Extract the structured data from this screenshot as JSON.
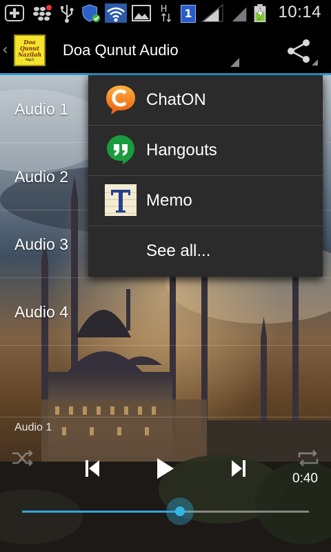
{
  "status_bar": {
    "time": "10:14",
    "network_type": "H",
    "notification_count": "1",
    "icons": [
      "add-icon",
      "blackberry-icon",
      "usb-icon",
      "shield-check-icon",
      "wifi-icon",
      "image-icon",
      "hspa-data-icon",
      "notification-badge-icon",
      "signal-icon",
      "battery-charging-icon"
    ]
  },
  "action_bar": {
    "app_logo_lines": [
      "Doa",
      "Qunut",
      "Nazilah",
      "Mp3"
    ],
    "title": "Doa Qunut Audio",
    "icons": [
      "back-chevron-icon",
      "share-icon"
    ]
  },
  "audio_list": {
    "items": [
      {
        "label": "Audio 1"
      },
      {
        "label": "Audio 2"
      },
      {
        "label": "Audio 3"
      },
      {
        "label": "Audio 4"
      }
    ]
  },
  "player": {
    "now_playing": "Audio 1",
    "elapsed_time": "0:40",
    "progress_fraction": 0.55,
    "icons": [
      "shuffle-icon",
      "previous-icon",
      "play-icon",
      "next-icon",
      "repeat-icon"
    ]
  },
  "share_menu": {
    "items": [
      {
        "label": "ChatON",
        "icon": "chaton-icon"
      },
      {
        "label": "Hangouts",
        "icon": "hangouts-icon"
      },
      {
        "label": "Memo",
        "icon": "memo-icon"
      },
      {
        "label": "See all..."
      }
    ]
  },
  "colors": {
    "accent": "#33b5e5",
    "menu_background": "#2b2b2b",
    "action_bar_divider": "#2e9fd8"
  }
}
